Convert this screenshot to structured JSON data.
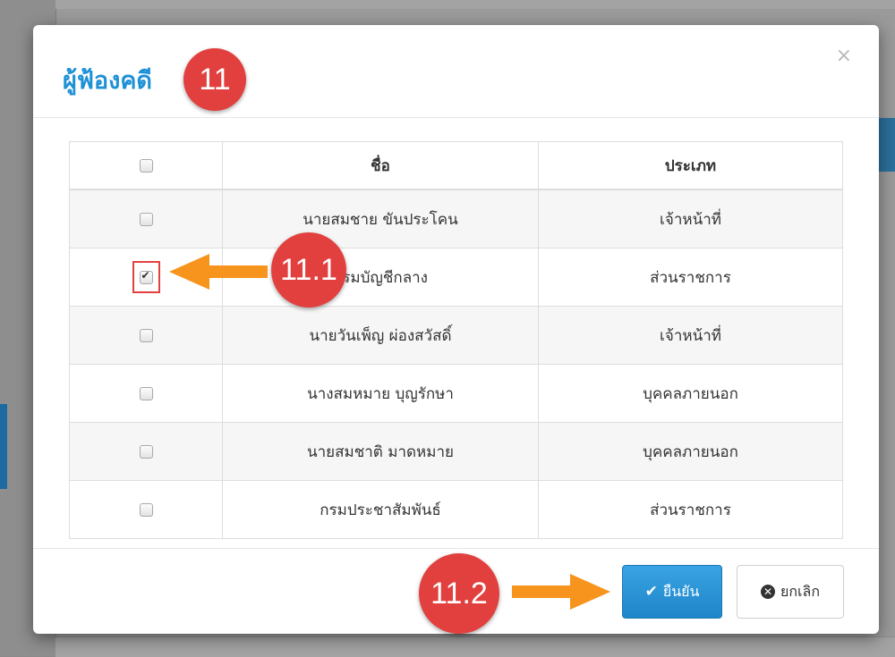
{
  "modal": {
    "title": "ผู้ฟ้องคดี",
    "close_glyph": "×"
  },
  "table": {
    "headers": {
      "select_all": "",
      "name": "ชื่อ",
      "type": "ประเภท"
    },
    "rows": [
      {
        "name": "นายสมชาย ขันประโคน",
        "type": "เจ้าหน้าที่",
        "checked": false
      },
      {
        "name": "กรมบัญชีกลาง",
        "type": "ส่วนราชการ",
        "checked": true
      },
      {
        "name": "นายวันเพ็ญ ผ่องสวัสดิ์",
        "type": "เจ้าหน้าที่",
        "checked": false
      },
      {
        "name": "นางสมหมาย บุญรักษา",
        "type": "บุคคลภายนอก",
        "checked": false
      },
      {
        "name": "นายสมชาติ มาดหมาย",
        "type": "บุคคลภายนอก",
        "checked": false
      },
      {
        "name": "กรมประชาสัมพันธ์",
        "type": "ส่วนราชการ",
        "checked": false
      }
    ]
  },
  "footer": {
    "confirm_label": "ยืนยัน",
    "cancel_label": "ยกเลิก",
    "confirm_icon": "check-icon",
    "cancel_icon": "times-circle-icon"
  },
  "annotations": {
    "step_main": "11",
    "step_checkbox": "11.1",
    "step_confirm": "11.2",
    "callout_color": "#e2403e",
    "arrow_color": "#f7941d"
  },
  "colors": {
    "title": "#1e90d6",
    "primary_button": "#2196d9"
  }
}
